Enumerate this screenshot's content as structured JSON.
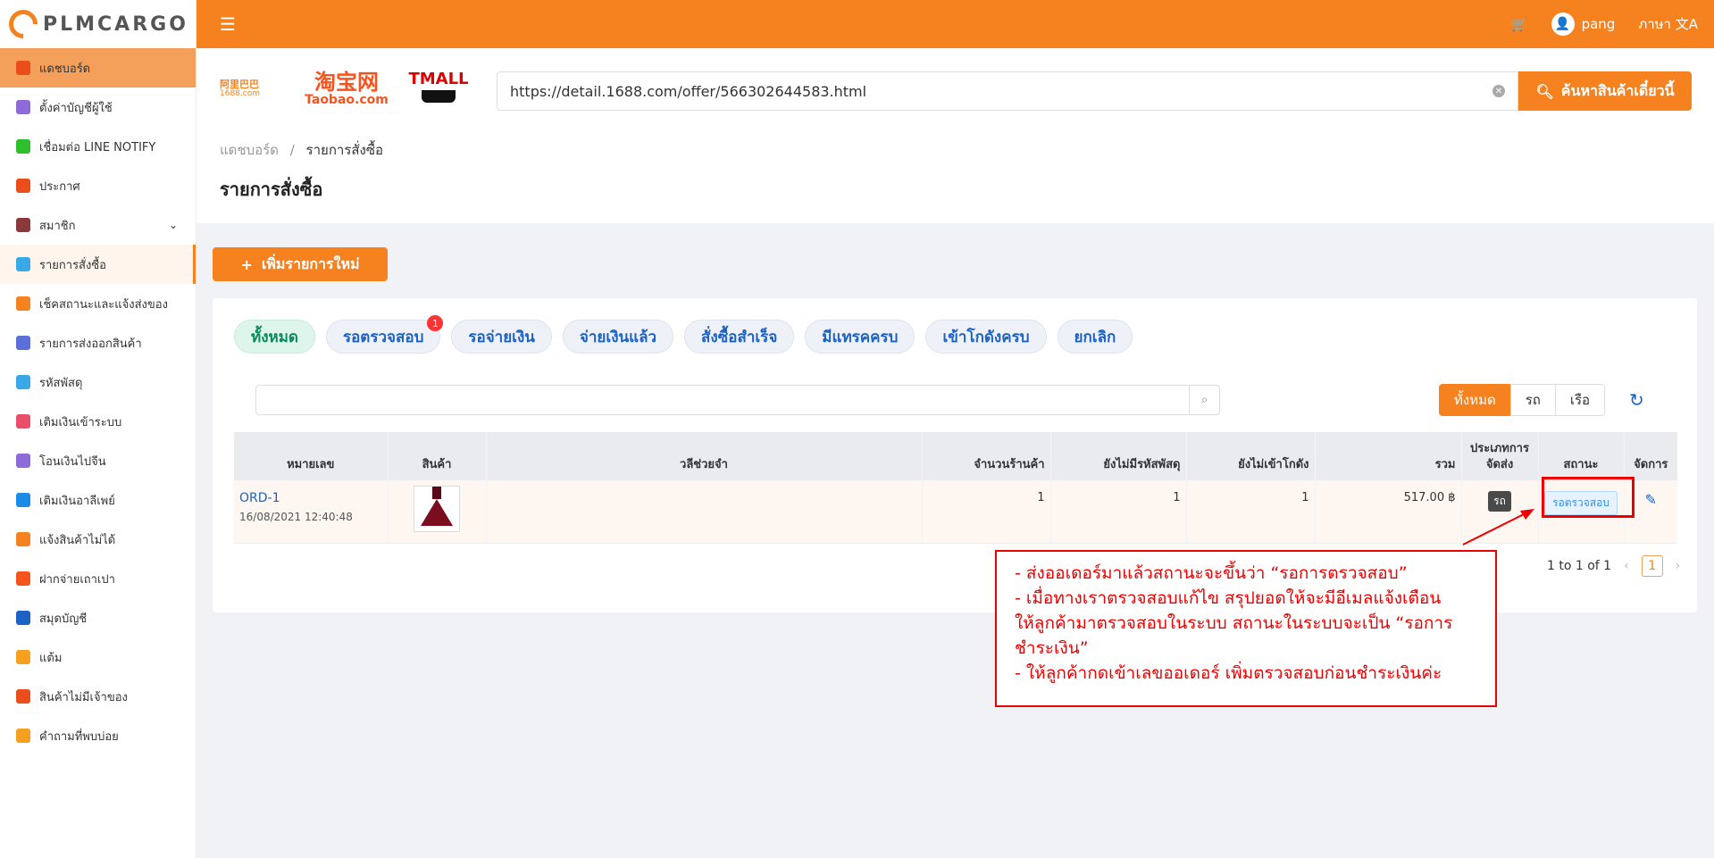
{
  "app": {
    "brand": "PLMCARGO"
  },
  "topbar": {
    "user": "pang",
    "language": "ภาษา"
  },
  "sidebar": {
    "items": [
      {
        "label": "แดชบอร์ด",
        "icon": "chart-icon",
        "color": "#e94e1b"
      },
      {
        "label": "ตั้งค่าบัญชีผู้ใช้",
        "icon": "user-settings-icon",
        "color": "#8e6bd8"
      },
      {
        "label": "เชื่อมต่อ LINE NOTIFY",
        "icon": "line-icon",
        "color": "#2ebf2e"
      },
      {
        "label": "ประกาศ",
        "icon": "megaphone-icon",
        "color": "#e94e1b"
      },
      {
        "label": "สมาชิก",
        "icon": "member-icon",
        "color": "#8a3a3a"
      },
      {
        "label": "รายการสั่งซื้อ",
        "icon": "basket-icon",
        "color": "#3aa8e6"
      },
      {
        "label": "เช็คสถานะและแจ้งส่งของ",
        "icon": "truck-icon",
        "color": "#f5821f"
      },
      {
        "label": "รายการส่งออกสินค้า",
        "icon": "dolly-icon",
        "color": "#5a6fd8"
      },
      {
        "label": "รหัสพัสดุ",
        "icon": "box-icon",
        "color": "#3aa8e6"
      },
      {
        "label": "เติมเงินเข้าระบบ",
        "icon": "piggy-bank-icon",
        "color": "#e94e6a"
      },
      {
        "label": "โอนเงินไปจีน",
        "icon": "yuan-icon",
        "color": "#8e6bd8"
      },
      {
        "label": "เติมเงินอาลีเพย์",
        "icon": "alipay-icon",
        "color": "#1b8ce6"
      },
      {
        "label": "แจ้งสินค้าไม่ได้",
        "icon": "no-product-icon",
        "color": "#f5821f"
      },
      {
        "label": "ฝากจ่ายเถาเปา",
        "icon": "taobao-icon",
        "color": "#f5541f"
      },
      {
        "label": "สมุดบัญชี",
        "icon": "wallet-icon",
        "color": "#1b62c4"
      },
      {
        "label": "แต้ม",
        "icon": "medal-icon",
        "color": "#f5a01f"
      },
      {
        "label": "สินค้าไม่มีเจ้าของ",
        "icon": "search-box-icon",
        "color": "#e94e1b"
      },
      {
        "label": "คำถามที่พบบ่อย",
        "icon": "question-icon",
        "color": "#f5a01f"
      }
    ]
  },
  "header": {
    "brands": {
      "alibaba": "阿里巴巴",
      "alibaba_sub": "1688.com",
      "taobao": "淘宝网",
      "taobao_sub": "Taobao.com",
      "tmall": "TMALL"
    },
    "search_value": "https://detail.1688.com/offer/566302644583.html",
    "search_button": "ค้นหาสินค้าเดี๋ยวนี้",
    "breadcrumb": {
      "home": "แดชบอร์ด",
      "sep": "/",
      "current": "รายการสั่งซื้อ"
    },
    "title": "รายการสั่งซื้อ"
  },
  "main": {
    "add_button": "เพิ่มรายการใหม่",
    "tabs": [
      {
        "label": "ทั้งหมด",
        "badge": ""
      },
      {
        "label": "รอตรวจสอบ",
        "badge": "1"
      },
      {
        "label": "รอจ่ายเงิน",
        "badge": ""
      },
      {
        "label": "จ่ายเงินแล้ว",
        "badge": ""
      },
      {
        "label": "สั่งซื้อสำเร็จ",
        "badge": ""
      },
      {
        "label": "มีแทรคครบ",
        "badge": ""
      },
      {
        "label": "เข้าโกดังครบ",
        "badge": ""
      },
      {
        "label": "ยกเลิก",
        "badge": ""
      }
    ],
    "filter": {
      "all": "ทั้งหมด",
      "car": "รถ",
      "boat": "เรือ"
    },
    "table": {
      "headers": {
        "id": "หมายเลข",
        "product": "สินค้า",
        "memo": "วลีช่วยจำ",
        "shops": "จำนวนร้านค้า",
        "no_tracking": "ยังไม่มีรหัสพัสดุ",
        "not_in_warehouse": "ยังไม่เข้าโกดัง",
        "total": "รวม",
        "ship_type_1": "ประเภทการ",
        "ship_type_2": "จัดส่ง",
        "status": "สถานะ",
        "manage": "จัดการ"
      },
      "rows": [
        {
          "id": "ORD-1",
          "date": "16/08/2021 12:40:48",
          "memo": "",
          "shops": "1",
          "no_tracking": "1",
          "not_in_warehouse": "1",
          "total": "517.00 ฿",
          "ship_type": "รถ",
          "status": "รอตรวจสอบ"
        }
      ]
    },
    "pager": {
      "summary": "1 to 1 of 1",
      "page": "1"
    }
  },
  "annotation": {
    "lines": [
      "- ส่งออเดอร์มาแล้วสถานะจะขึ้นว่า “รอการตรวจสอบ”",
      "- เมื่อทางเราตรวจสอบแก้ไข สรุปยอดให้จะมีอีเมลแจ้งเตือน",
      "ให้ลูกค้ามาตรวจสอบในระบบ สถานะในระบบจะเป็น “รอการ",
      "ชำระเงิน”",
      "- ให้ลูกค้ากดเข้าเลขออเดอร์ เพิ่มตรวจสอบก่อนชำระเงินค่ะ"
    ]
  }
}
